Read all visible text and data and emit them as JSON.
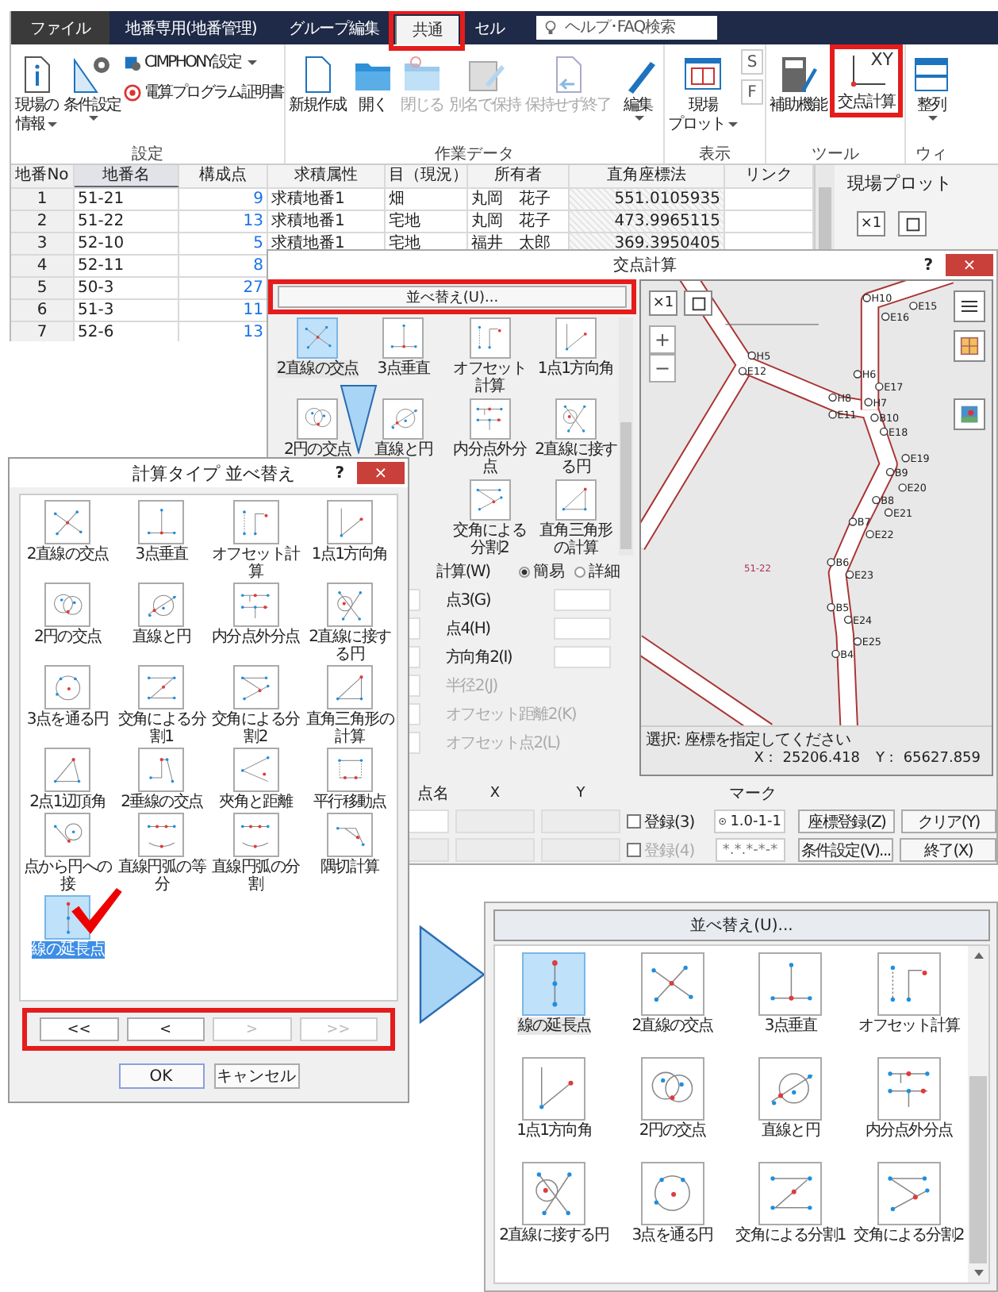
{
  "app": {
    "tabs": [
      {
        "label": "ファイル",
        "kind": "file",
        "selected": false,
        "highlighted": false
      },
      {
        "label": "地番専用(地番管理)",
        "kind": "tab",
        "selected": false,
        "highlighted": false
      },
      {
        "label": "グループ編集",
        "kind": "tab",
        "selected": false,
        "highlighted": false
      },
      {
        "label": "共通",
        "kind": "tab",
        "selected": true,
        "highlighted": true
      },
      {
        "label": "セル",
        "kind": "tab",
        "selected": false,
        "highlighted": false
      }
    ],
    "search": {
      "placeholder": "ヘルプ･FAQ検索"
    },
    "ribbon_groups": [
      {
        "label": "設定",
        "items": [
          {
            "kind": "large",
            "label_lines": [
              "現場の",
              "情報"
            ],
            "dropdown": true,
            "disabled": false,
            "highlighted": false
          },
          {
            "kind": "large",
            "label": "条件設定",
            "dropdown": true,
            "disabled": false,
            "highlighted": false
          },
          {
            "kind": "stack",
            "items": [
              {
                "kind": "small",
                "label": "CIMPHONY設定",
                "dropdown": true,
                "disabled": false
              },
              {
                "kind": "small",
                "label": "電算プログラム証明書",
                "dropdown": false,
                "disabled": false
              }
            ]
          }
        ]
      },
      {
        "label": "作業データ",
        "items": [
          {
            "kind": "large",
            "label": "新規作成",
            "dropdown": false,
            "disabled": false,
            "highlighted": false
          },
          {
            "kind": "large",
            "label": "開く",
            "dropdown": false,
            "disabled": false,
            "highlighted": false
          },
          {
            "kind": "large",
            "label": "閉じる",
            "dropdown": false,
            "disabled": true,
            "highlighted": false
          },
          {
            "kind": "large",
            "label": "別名で保持",
            "dropdown": false,
            "disabled": true,
            "highlighted": false
          },
          {
            "kind": "large",
            "label": "保持せず終了",
            "dropdown": false,
            "disabled": true,
            "highlighted": false
          },
          {
            "kind": "large",
            "label": "編集",
            "dropdown": true,
            "disabled": false,
            "highlighted": false
          }
        ]
      },
      {
        "label": "表示",
        "items": [
          {
            "kind": "large",
            "label_lines": [
              "現場",
              "プロット"
            ],
            "dropdown": true,
            "disabled": false,
            "highlighted": false
          },
          {
            "kind": "stack",
            "items": [
              {
                "kind": "letter",
                "label": "S"
              },
              {
                "kind": "letter",
                "label": "F"
              }
            ]
          }
        ]
      },
      {
        "label": "ツール",
        "items": [
          {
            "kind": "large",
            "label": "補助機能",
            "dropdown": false,
            "disabled": false,
            "highlighted": false
          },
          {
            "kind": "large",
            "label": "交点計算",
            "icon_text": "XY",
            "dropdown": false,
            "disabled": false,
            "highlighted": true
          }
        ]
      },
      {
        "label": "ウィ",
        "items": [
          {
            "kind": "large",
            "label": "整列",
            "dropdown": true,
            "disabled": false,
            "highlighted": false
          }
        ]
      }
    ],
    "table": {
      "columns": [
        "地番No",
        "地番名",
        "構成点",
        "求積属性",
        "目（現況）",
        "所有者",
        "直角座標法",
        "リンク"
      ],
      "rows": [
        [
          "1",
          "51-21",
          "9",
          "求積地番1",
          "畑",
          "丸岡　花子",
          "551.0105935"
        ],
        [
          "2",
          "51-22",
          "13",
          "求積地番1",
          "宅地",
          "丸岡　花子",
          "473.9965115"
        ],
        [
          "3",
          "52-10",
          "5",
          "求積地番1",
          "宅地",
          "福井　太郎",
          "369.3950405"
        ],
        [
          "4",
          "52-11",
          "8"
        ],
        [
          "5",
          "50-3",
          "27"
        ],
        [
          "6",
          "51-3",
          "11"
        ],
        [
          "7",
          "52-6",
          "13"
        ]
      ]
    },
    "plot_panel": {
      "title": "現場プロット",
      "zoom_button": "×1"
    }
  },
  "calc_dialog": {
    "title": "交点計算",
    "help": "?",
    "close": "×",
    "sort_button": "並べ替え(U)...",
    "types": [
      {
        "label": "2直線の交点",
        "kind": "cross",
        "selected": true
      },
      {
        "label": "3点垂直",
        "kind": "perp",
        "selected": false
      },
      {
        "label": "オフセット計算",
        "kind": "offset",
        "selected": false
      },
      {
        "label": "1点1方向角",
        "kind": "direction",
        "selected": false
      },
      {
        "label": "2円の交点",
        "kind": "circles",
        "selected": false
      },
      {
        "label": "直線と円",
        "kind": "linecircle",
        "selected": false
      },
      {
        "label": "内分点外分点",
        "kind": "division",
        "selected": false
      },
      {
        "label": "2直線に接する円",
        "kind": "tangent",
        "selected": false
      },
      {
        "label": "交角による分割2",
        "kind": "angle2",
        "selected": false
      },
      {
        "label": "直角三角形の計算",
        "kind": "triangle",
        "selected": false
      }
    ],
    "calc_mode": {
      "label": "計算(W)",
      "options": [
        {
          "label": "簡易",
          "selected": true
        },
        {
          "label": "詳細",
          "selected": false
        }
      ]
    },
    "fields": [
      {
        "label": "点3(G)",
        "disabled": false
      },
      {
        "label": "点4(H)",
        "disabled": false
      },
      {
        "label": "方向角2(I)",
        "disabled": false
      },
      {
        "label": "半径2(J)",
        "disabled": true
      },
      {
        "label": "オフセット距離2(K)",
        "disabled": true
      },
      {
        "label": "オフセット点2(L)",
        "disabled": true
      }
    ],
    "map": {
      "zoom_button": "×1",
      "zoom_in": "+",
      "zoom_out": "−",
      "parcel": "51-22",
      "points": [
        "H10",
        "E15",
        "E16",
        "H5",
        "E12",
        "H6",
        "E17",
        "H8",
        "H7",
        "E11",
        "B10",
        "E18",
        "E19",
        "B9",
        "E20",
        "B8",
        "E21",
        "B7",
        "E22",
        "B6",
        "E23",
        "B5",
        "E24",
        "E25",
        "B4"
      ],
      "status": "選択: 座標を指定してください",
      "x_label": "X :",
      "x_value": "25206.418",
      "y_label": "Y :",
      "y_value": "65627.859"
    },
    "result_headers": [
      "点名",
      "X",
      "Y",
      "マーク"
    ],
    "result_rows": [
      {
        "register": "登録(3)",
        "checked": false,
        "disabled": false,
        "mark": "1.0-1-1",
        "mark_icon": true,
        "buttons": [
          "座標登録(Z)",
          "クリア(Y)"
        ]
      },
      {
        "register": "登録(4)",
        "checked": false,
        "disabled": true,
        "mark": "*.*.*-*-*",
        "mark_icon": false,
        "buttons": [
          "条件設定(V)...",
          "終了(X)"
        ]
      }
    ]
  },
  "sort_dialog": {
    "title": "計算タイプ 並べ替え",
    "help": "?",
    "close": "×",
    "types": [
      {
        "label": "2直線の交点",
        "kind": "cross",
        "selected": false
      },
      {
        "label": "3点垂直",
        "kind": "perp",
        "selected": false
      },
      {
        "label": "オフセット計算",
        "kind": "offset",
        "selected": false
      },
      {
        "label": "1点1方向角",
        "kind": "direction",
        "selected": false
      },
      {
        "label": "2円の交点",
        "kind": "circles",
        "selected": false
      },
      {
        "label": "直線と円",
        "kind": "linecircle",
        "selected": false
      },
      {
        "label": "内分点外分点",
        "kind": "division",
        "selected": false
      },
      {
        "label": "2直線に接する円",
        "kind": "tangent",
        "selected": false
      },
      {
        "label": "3点を通る円",
        "kind": "circle3",
        "selected": false
      },
      {
        "label": "交角による分割1",
        "kind": "angle",
        "selected": false
      },
      {
        "label": "交角による分割2",
        "kind": "angle2",
        "selected": false
      },
      {
        "label": "直角三角形の計算",
        "kind": "triangle",
        "selected": false
      },
      {
        "label": "2点1辺頂角",
        "kind": "vertex",
        "selected": false
      },
      {
        "label": "2垂線の交点",
        "kind": "perp2",
        "selected": false
      },
      {
        "label": "夾角と距離",
        "kind": "angledist",
        "selected": false
      },
      {
        "label": "平行移動点",
        "kind": "parallel",
        "selected": false
      },
      {
        "label": "点から円への接",
        "kind": "tangentpoint",
        "selected": false
      },
      {
        "label": "直線円弧の等分",
        "kind": "arc",
        "selected": false
      },
      {
        "label": "直線円弧の分割",
        "kind": "arc",
        "selected": false
      },
      {
        "label": "隅切計算",
        "kind": "corner",
        "selected": false
      },
      {
        "label": "線の延長点",
        "kind": "extension",
        "selected": true
      }
    ],
    "nav": [
      {
        "label": "<<",
        "disabled": false
      },
      {
        "label": "<",
        "disabled": false
      },
      {
        "label": ">",
        "disabled": true
      },
      {
        "label": ">>",
        "disabled": true
      }
    ],
    "ok": "OK",
    "cancel": "キャンセル"
  },
  "result_panel": {
    "sort_button": "並べ替え(U)...",
    "types": [
      {
        "label": "線の延長点",
        "kind": "extension",
        "selected": true
      },
      {
        "label": "2直線の交点",
        "kind": "cross",
        "selected": false
      },
      {
        "label": "3点垂直",
        "kind": "perp",
        "selected": false
      },
      {
        "label": "オフセット計算",
        "kind": "offset",
        "selected": false
      },
      {
        "label": "1点1方向角",
        "kind": "direction",
        "selected": false
      },
      {
        "label": "2円の交点",
        "kind": "circles",
        "selected": false
      },
      {
        "label": "直線と円",
        "kind": "linecircle",
        "selected": false
      },
      {
        "label": "内分点外分点",
        "kind": "division",
        "selected": false
      },
      {
        "label": "2直線に接する円",
        "kind": "tangent",
        "selected": false
      },
      {
        "label": "3点を通る円",
        "kind": "circle3",
        "selected": false
      },
      {
        "label": "交角による分割1",
        "kind": "angle",
        "selected": false
      },
      {
        "label": "交角による分割2",
        "kind": "angle2",
        "selected": false
      }
    ]
  }
}
